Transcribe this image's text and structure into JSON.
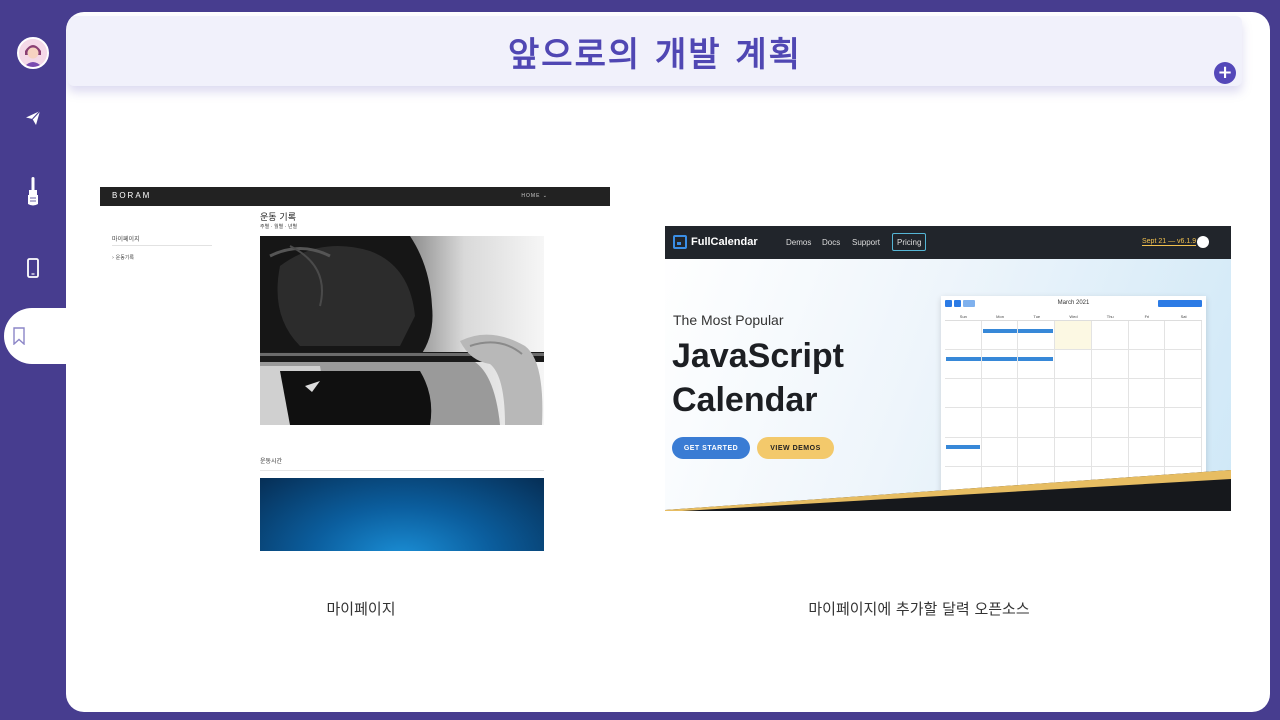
{
  "page": {
    "title": "앞으로의 개발 계획",
    "add_label": "+"
  },
  "sidebar": {
    "items": [
      {
        "name": "avatar"
      },
      {
        "name": "send-icon"
      },
      {
        "name": "brush-icon"
      },
      {
        "name": "mobile-icon"
      },
      {
        "name": "bookmark-icon",
        "active": true
      }
    ]
  },
  "panels": [
    {
      "caption": "마이페이지",
      "screenshot": {
        "logo": "BORAM",
        "nav": "HOME ⌄",
        "sidebar_title": "마이페이지",
        "sidebar_item": "› 운동기록",
        "heading": "운동 기록",
        "subheading": "주별 · 월별 · 년별",
        "section2_heading": "운동시간"
      }
    },
    {
      "caption": "마이페이지에 추가할 달력 오픈소스",
      "screenshot": {
        "brand": "FullCalendar",
        "nav": [
          "Demos",
          "Docs",
          "Support"
        ],
        "pricing": "Pricing",
        "version": "Sept 21 — v6.1.9",
        "tagline": "The Most Popular",
        "hero": "JavaScript Calendar",
        "cta_primary": "GET STARTED",
        "cta_secondary": "VIEW DEMOS",
        "calendar": {
          "month": "March 2021",
          "weekdays": [
            "Sun",
            "Mon",
            "Tue",
            "Wed",
            "Thu",
            "Fri",
            "Sat"
          ]
        }
      }
    }
  ],
  "colors": {
    "background": "#473d8f",
    "accent": "#5047b3",
    "banner": "#f1f1fb",
    "card": "#ffffff"
  }
}
